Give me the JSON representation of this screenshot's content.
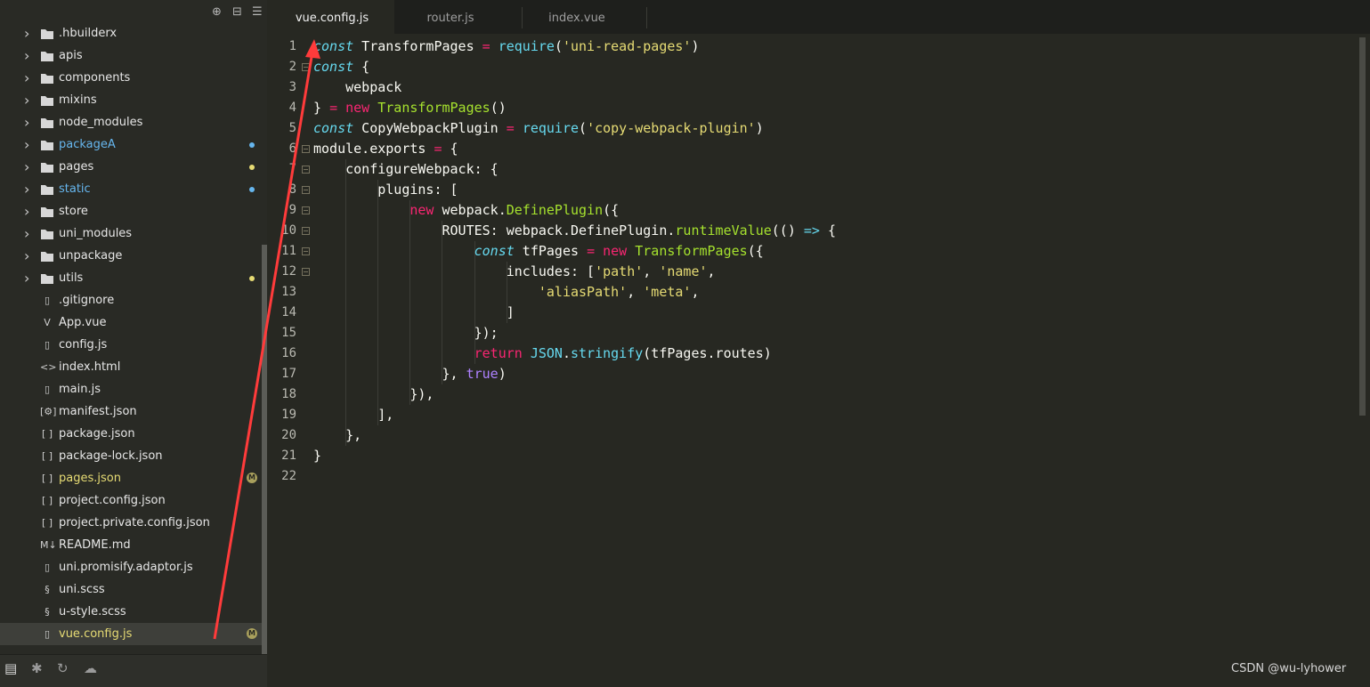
{
  "sidebar": {
    "toolbar": [
      "target-icon",
      "collapse-all-icon",
      "menu-icon"
    ],
    "items": [
      {
        "label": ".hbuilderx",
        "type": "folder",
        "status": "",
        "selected": false
      },
      {
        "label": "apis",
        "type": "folder",
        "status": "",
        "selected": false
      },
      {
        "label": "components",
        "type": "folder",
        "status": "",
        "selected": false
      },
      {
        "label": "mixins",
        "type": "folder",
        "status": "",
        "selected": false
      },
      {
        "label": "node_modules",
        "type": "folder",
        "status": "",
        "selected": false
      },
      {
        "label": "packageA",
        "type": "folder",
        "status": "new",
        "selected": false
      },
      {
        "label": "pages",
        "type": "folder",
        "status": "mod-dot",
        "selected": false
      },
      {
        "label": "static",
        "type": "folder",
        "status": "new",
        "selected": false
      },
      {
        "label": "store",
        "type": "folder",
        "status": "",
        "selected": false
      },
      {
        "label": "uni_modules",
        "type": "folder",
        "status": "",
        "selected": false
      },
      {
        "label": "unpackage",
        "type": "folder",
        "status": "",
        "selected": false
      },
      {
        "label": "utils",
        "type": "folder",
        "status": "mod-dot",
        "selected": false
      },
      {
        "label": ".gitignore",
        "type": "file",
        "icon": "file-icon",
        "status": "",
        "selected": false
      },
      {
        "label": "App.vue",
        "type": "file",
        "icon": "vue-file-icon",
        "status": "",
        "selected": false
      },
      {
        "label": "config.js",
        "type": "file",
        "icon": "js-file-icon",
        "status": "",
        "selected": false
      },
      {
        "label": "index.html",
        "type": "file",
        "icon": "html-file-icon",
        "status": "",
        "selected": false
      },
      {
        "label": "main.js",
        "type": "file",
        "icon": "js-file-icon",
        "status": "",
        "selected": false
      },
      {
        "label": "manifest.json",
        "type": "file",
        "icon": "manifest-icon",
        "status": "",
        "selected": false
      },
      {
        "label": "package.json",
        "type": "file",
        "icon": "json-file-icon",
        "status": "",
        "selected": false
      },
      {
        "label": "package-lock.json",
        "type": "file",
        "icon": "json-file-icon",
        "status": "",
        "selected": false
      },
      {
        "label": "pages.json",
        "type": "file",
        "icon": "json-file-icon",
        "status": "M",
        "selected": false
      },
      {
        "label": "project.config.json",
        "type": "file",
        "icon": "json-file-icon",
        "status": "",
        "selected": false
      },
      {
        "label": "project.private.config.json",
        "type": "file",
        "icon": "json-file-icon",
        "status": "",
        "selected": false
      },
      {
        "label": "README.md",
        "type": "file",
        "icon": "markdown-icon",
        "status": "",
        "selected": false
      },
      {
        "label": "uni.promisify.adaptor.js",
        "type": "file",
        "icon": "js-file-icon",
        "status": "",
        "selected": false
      },
      {
        "label": "uni.scss",
        "type": "file",
        "icon": "sass-file-icon",
        "status": "",
        "selected": false
      },
      {
        "label": "u-style.scss",
        "type": "file",
        "icon": "sass-file-icon",
        "status": "",
        "selected": false
      },
      {
        "label": "vue.config.js",
        "type": "file",
        "icon": "js-file-icon",
        "status": "M",
        "selected": true
      }
    ],
    "bottom_icons": [
      "explorer-icon",
      "debug-icon",
      "source-control-icon",
      "cloud-icon"
    ]
  },
  "tabs": [
    {
      "label": "vue.config.js",
      "active": true
    },
    {
      "label": "router.js",
      "active": false
    },
    {
      "label": "index.vue",
      "active": false
    }
  ],
  "editor": {
    "line_numbers": [
      "1",
      "2",
      "3",
      "4",
      "5",
      "6",
      "7",
      "8",
      "9",
      "10",
      "11",
      "12",
      "13",
      "14",
      "15",
      "16",
      "17",
      "18",
      "19",
      "20",
      "21",
      "22"
    ],
    "fold_lines": [
      2,
      6,
      7,
      8,
      9,
      10,
      11,
      12
    ],
    "lines": [
      [
        [
          "it",
          "const"
        ],
        [
          "pl",
          " TransformPages "
        ],
        [
          "kw",
          "="
        ],
        [
          "pl",
          " "
        ],
        [
          "bi",
          "require"
        ],
        [
          "pl",
          "("
        ],
        [
          "str",
          "'uni-read-pages'"
        ],
        [
          "pl",
          ")"
        ]
      ],
      [
        [
          "it",
          "const"
        ],
        [
          "pl",
          " {"
        ]
      ],
      [
        [
          "pl",
          "    webpack"
        ]
      ],
      [
        [
          "pl",
          "} "
        ],
        [
          "kw",
          "="
        ],
        [
          "pl",
          " "
        ],
        [
          "kw",
          "new"
        ],
        [
          "pl",
          " "
        ],
        [
          "fn",
          "TransformPages"
        ],
        [
          "pl",
          "()"
        ]
      ],
      [
        [
          "it",
          "const"
        ],
        [
          "pl",
          " CopyWebpackPlugin "
        ],
        [
          "kw",
          "="
        ],
        [
          "pl",
          " "
        ],
        [
          "bi",
          "require"
        ],
        [
          "pl",
          "("
        ],
        [
          "str",
          "'copy-webpack-plugin'"
        ],
        [
          "pl",
          ")"
        ]
      ],
      [
        [
          "pl",
          "module.exports "
        ],
        [
          "kw",
          "="
        ],
        [
          "pl",
          " {"
        ]
      ],
      [
        [
          "pl",
          "    configureWebpack: {"
        ]
      ],
      [
        [
          "pl",
          "        plugins: ["
        ]
      ],
      [
        [
          "pl",
          "            "
        ],
        [
          "kw",
          "new"
        ],
        [
          "pl",
          " webpack."
        ],
        [
          "fn",
          "DefinePlugin"
        ],
        [
          "pl",
          "({"
        ]
      ],
      [
        [
          "pl",
          "                ROUTES: webpack.DefinePlugin."
        ],
        [
          "fn",
          "runtimeValue"
        ],
        [
          "pl",
          "(() "
        ],
        [
          "bi",
          "=>"
        ],
        [
          "pl",
          " {"
        ]
      ],
      [
        [
          "pl",
          "                    "
        ],
        [
          "it",
          "const"
        ],
        [
          "pl",
          " tfPages "
        ],
        [
          "kw",
          "="
        ],
        [
          "pl",
          " "
        ],
        [
          "kw",
          "new"
        ],
        [
          "pl",
          " "
        ],
        [
          "fn",
          "TransformPages"
        ],
        [
          "pl",
          "({"
        ]
      ],
      [
        [
          "pl",
          "                        includes: ["
        ],
        [
          "str",
          "'path'"
        ],
        [
          "pl",
          ", "
        ],
        [
          "str",
          "'name'"
        ],
        [
          "pl",
          ","
        ]
      ],
      [
        [
          "pl",
          "                            "
        ],
        [
          "str",
          "'aliasPath'"
        ],
        [
          "pl",
          ", "
        ],
        [
          "str",
          "'meta'"
        ],
        [
          "pl",
          ","
        ]
      ],
      [
        [
          "pl",
          "                        ]"
        ]
      ],
      [
        [
          "pl",
          "                    });"
        ]
      ],
      [
        [
          "pl",
          "                    "
        ],
        [
          "kw",
          "return"
        ],
        [
          "pl",
          " "
        ],
        [
          "bi",
          "JSON"
        ],
        [
          "pl",
          "."
        ],
        [
          "bi",
          "stringify"
        ],
        [
          "pl",
          "(tfPages.routes)"
        ]
      ],
      [
        [
          "pl",
          "                }, "
        ],
        [
          "num",
          "true"
        ],
        [
          "pl",
          ")"
        ]
      ],
      [
        [
          "pl",
          "            }),"
        ]
      ],
      [
        [
          "pl",
          "        ],"
        ]
      ],
      [
        [
          "pl",
          "    },"
        ]
      ],
      [
        [
          "pl",
          "}"
        ]
      ],
      [
        [
          "pl",
          ""
        ]
      ]
    ]
  },
  "watermark": "CSDN @wu-lyhower",
  "colors": {
    "sidebar_bg": "#292a25",
    "editor_bg": "#272822",
    "keyword": "#f92672",
    "function": "#a6e22e",
    "string": "#e6db74",
    "builtin": "#66d9ef",
    "number": "#ae81ff",
    "annotation_arrow": "#ff3b3b"
  }
}
